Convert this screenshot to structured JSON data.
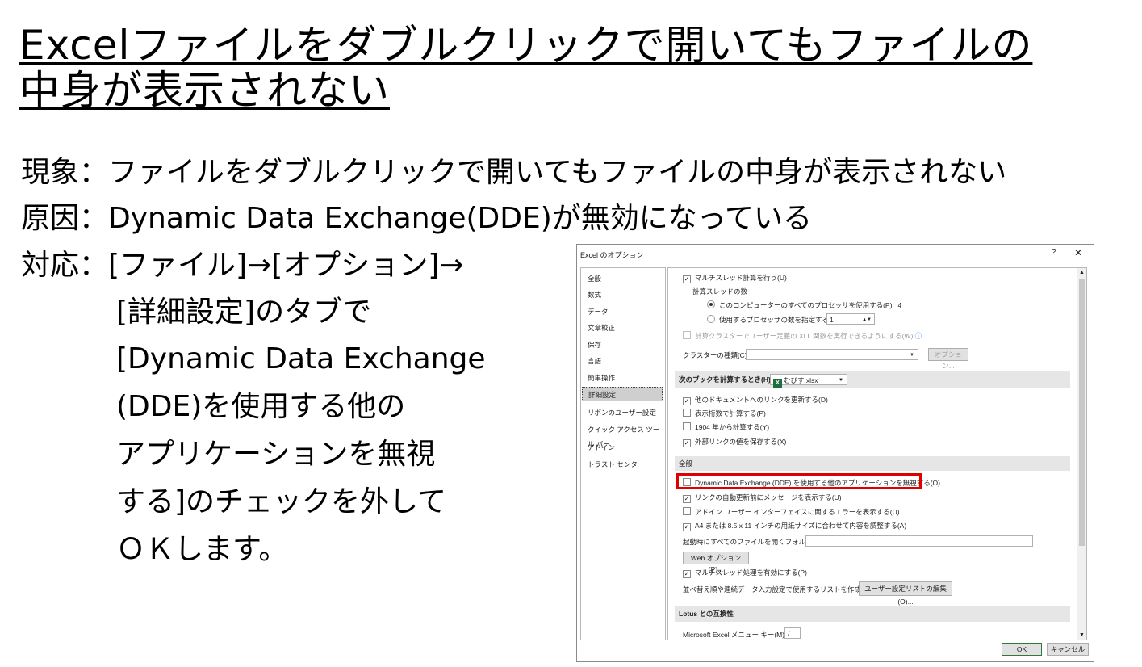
{
  "title_line1": "Excelファイルをダブルクリックで開いてもファイルの",
  "title_line2": "中身が表示されない",
  "symptom": "現象：ファイルをダブルクリックで開いてもファイルの中身が表示されない",
  "cause": "原因：Dynamic Data Exchange(DDE)が無効になっている",
  "action": {
    "lead": "対応：[ファイル]→[オプション]→",
    "lines": [
      "[詳細設定]のタブで",
      "[Dynamic Data Exchange",
      "(DDE)を使用する他の",
      "アプリケーションを無視",
      "する]のチェックを外して",
      "ＯＫします。"
    ]
  },
  "dialog": {
    "title": "Excel のオプション",
    "help": "?",
    "close": "✕",
    "nav": [
      "全般",
      "数式",
      "データ",
      "文章校正",
      "保存",
      "言語",
      "簡単操作",
      "詳細設定",
      "リボンのユーザー設定",
      "クイック アクセス ツール バー",
      "アドイン",
      "トラスト センター"
    ],
    "selected_nav": "詳細設定",
    "multithread_calc": "マルチスレッド計算を行う(U)",
    "thread_count_label": "計算スレッドの数",
    "all_processors": "このコンピューターのすべてのプロセッサを使用する(P):",
    "all_processors_value": "4",
    "manual_processors": "使用するプロセッサの数を指定する(M):",
    "manual_processors_value": "1",
    "xll_cluster": "計算クラスターでユーザー定義の XLL 関数を実行できるようにする(W)",
    "cluster_type": "クラスターの種類(C):",
    "options_button": "オプション...",
    "workbook_section": "次のブックを計算するとき(H):",
    "workbook_name": "むびす.xlsx",
    "workbook_options": [
      {
        "label": "他のドキュメントへのリンクを更新する(D)",
        "checked": true
      },
      {
        "label": "表示桁数で計算する(P)",
        "checked": false
      },
      {
        "label": "1904 年から計算する(Y)",
        "checked": false
      },
      {
        "label": "外部リンクの値を保存する(X)",
        "checked": true
      }
    ],
    "general_section": "全般",
    "general_options": [
      {
        "label": "Dynamic Data Exchange (DDE) を使用する他のアプリケーションを無視する(O)",
        "checked": false
      },
      {
        "label": "リンクの自動更新前にメッセージを表示する(U)",
        "checked": true
      },
      {
        "label": "アドイン ユーザー インターフェイスに関するエラーを表示する(U)",
        "checked": false
      },
      {
        "label": "A4 または 8.5 x 11 インチの用紙サイズに合わせて内容を調整する(A)",
        "checked": true
      }
    ],
    "startup_folder": "起動時にすべてのファイルを開くフォルダー(L):",
    "web_options_button": "Web オプション(P)...",
    "multithread_processing": "マルチスレッド処理を有効にする(P)",
    "custom_list_label": "並べ替え順や連続データ入力設定で使用するリストを作成します:",
    "custom_list_button": "ユーザー設定リストの編集(O)...",
    "lotus_section": "Lotus との互換性",
    "menu_key_label": "Microsoft Excel メニュー キー(M):",
    "menu_key_value": "/",
    "ok": "OK",
    "cancel": "キャンセル"
  },
  "colors": {
    "highlight": "#e00000",
    "excel_green": "#1d6f42"
  }
}
